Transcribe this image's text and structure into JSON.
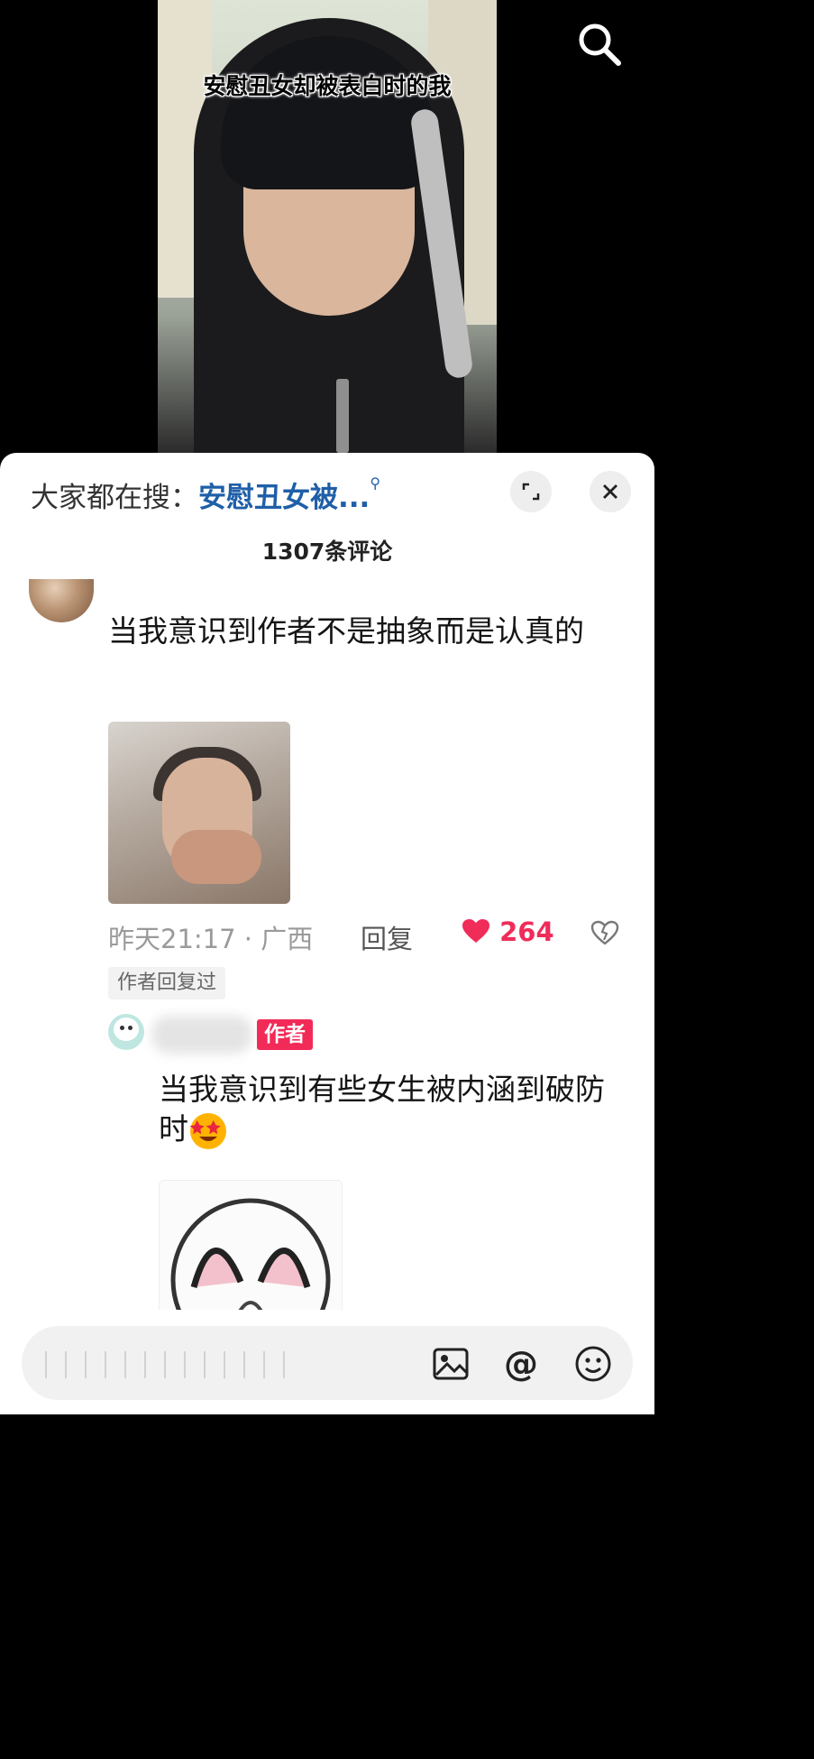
{
  "video": {
    "caption": "安慰丑女却被表白时的我"
  },
  "header": {
    "hot_search_prefix": "大家都在搜：",
    "hot_search_keyword": "安慰丑女被...",
    "comment_count": "1307条评论"
  },
  "comments": [
    {
      "text": "当我意识到作者不是抽象而是认真的",
      "time_location": "昨天21:17 · 广西",
      "reply_label": "回复",
      "likes": "264",
      "author_replied": "作者回复过"
    }
  ],
  "reply": {
    "tag": "作者",
    "text": "当我意识到有些女生被内涵到破防时"
  },
  "icons": {
    "search": "search-icon",
    "expand": "expand-icon",
    "close": "close-icon",
    "like": "heart-icon",
    "dislike": "broken-heart-icon",
    "image": "image-icon",
    "mention": "at-icon",
    "emoji": "emoji-icon"
  },
  "colors": {
    "accent": "#f02c59",
    "keyword": "#1f5fa8"
  },
  "input": {
    "mention_symbol": "@"
  }
}
